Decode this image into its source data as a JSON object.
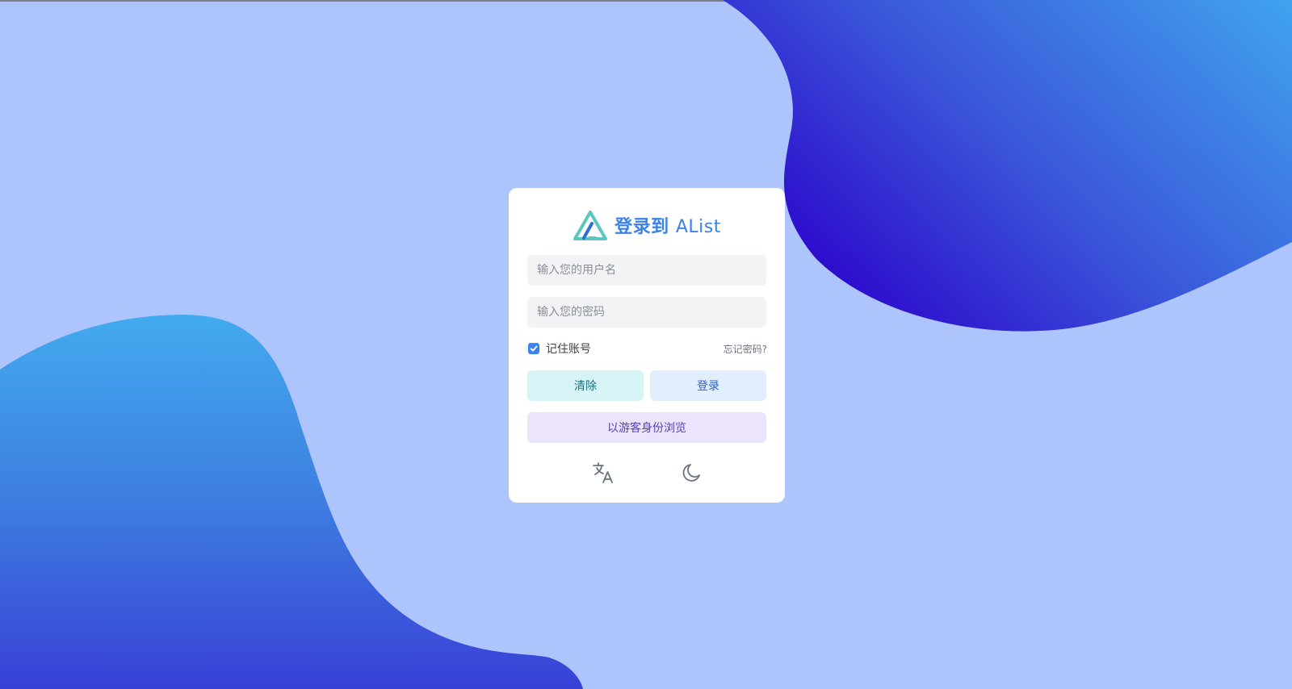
{
  "colors": {
    "background": "#adc4fc",
    "accent": "#3b82e8",
    "logo_teal": "#5cc6c0"
  },
  "login": {
    "title": "登录到",
    "title_brand": "AList",
    "username_placeholder": "输入您的用户名",
    "password_placeholder": "输入您的密码",
    "remember_label": "记住账号",
    "remember_checked": true,
    "forgot_label": "忘记密码?",
    "clear_label": "清除",
    "login_label": "登录",
    "guest_label": "以游客身份浏览"
  },
  "icons": {
    "logo": "alist-logo-icon",
    "checkbox": "check-icon",
    "language": "translate-icon",
    "theme": "moon-icon"
  }
}
